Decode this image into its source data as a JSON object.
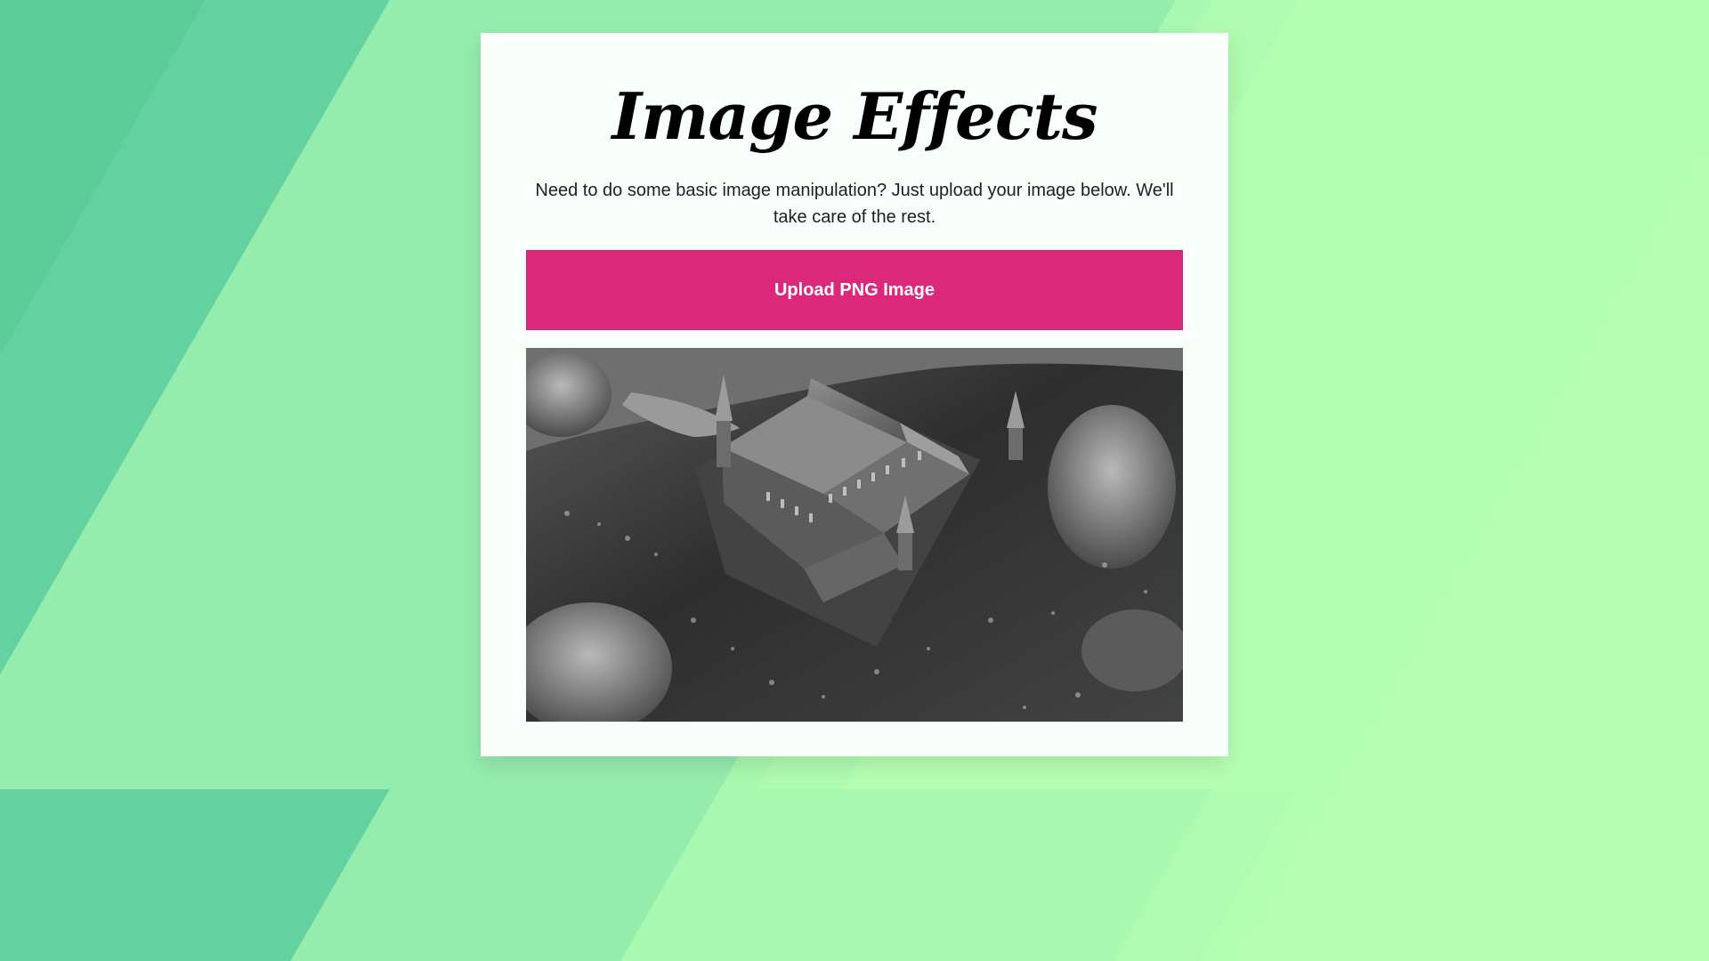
{
  "page": {
    "title": "Image Effects",
    "description": "Need to do some basic image manipulation? Just upload your image below. We'll take care of the rest."
  },
  "upload": {
    "button_label": "Upload PNG Image"
  },
  "preview": {
    "alt": "Black and white aerial view of a moated castle"
  },
  "colors": {
    "button": "#db277c",
    "card": "#f9fffb",
    "background_left": "#64d2a0",
    "background_mid": "#94ecad",
    "background_right": "#b6ffb1"
  }
}
